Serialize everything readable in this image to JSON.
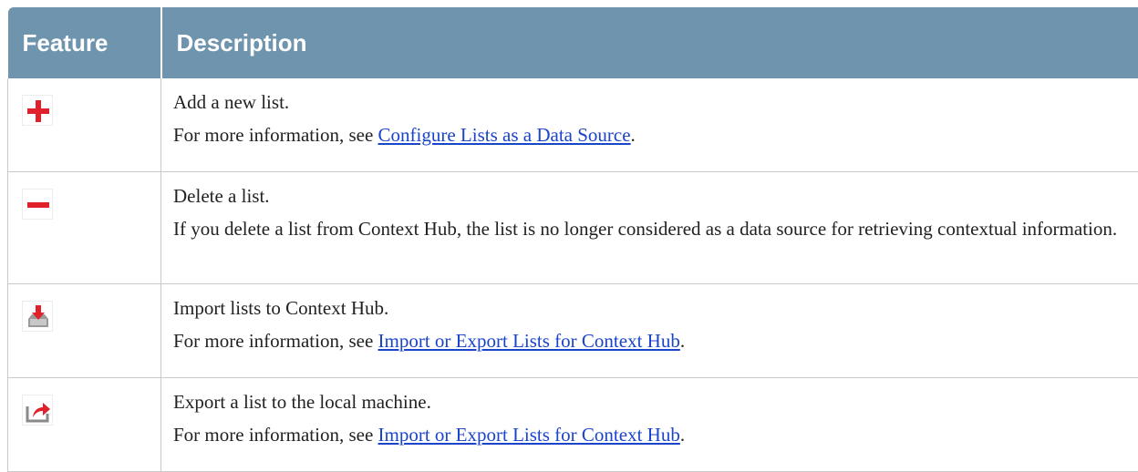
{
  "header": {
    "feature": "Feature",
    "description": "Description"
  },
  "rows": [
    {
      "icon": "add-icon",
      "line1": "Add a new list.",
      "line2_prefix": "For more information, see ",
      "line2_link": "Configure Lists as a Data Source",
      "line2_suffix": "."
    },
    {
      "icon": "delete-icon",
      "line1": "Delete a list.",
      "line2": "If you delete a list from Context Hub, the list is no longer considered as a data source for retrieving contextual information."
    },
    {
      "icon": "import-icon",
      "line1": "Import lists to Context Hub.",
      "line2_prefix": "For more information, see ",
      "line2_link": "Import or Export Lists for Context Hub",
      "line2_suffix": "."
    },
    {
      "icon": "export-icon",
      "line1": "Export a list to the local machine.",
      "line2_prefix": "For more information, see ",
      "line2_link": "Import or Export Lists for Context Hub",
      "line2_suffix": "."
    }
  ],
  "colors": {
    "header_bg": "#6f94ad",
    "link": "#1a44c9",
    "icon_red": "#e0202a"
  }
}
